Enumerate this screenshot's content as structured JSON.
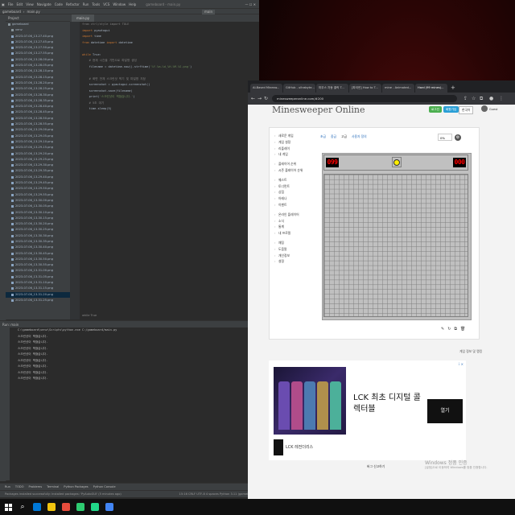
{
  "ide": {
    "menu": [
      "File",
      "Edit",
      "View",
      "Navigate",
      "Code",
      "Refactor",
      "Run",
      "Tools",
      "VCS",
      "Window",
      "Help"
    ],
    "window_title": "gameboard - main.py",
    "nav_project": "gameboard",
    "nav_file": "main.py",
    "run_config": "main",
    "project_header": "Project",
    "tab_label": "main.py",
    "tree": {
      "root": "gameboard",
      "venv": "venv",
      "files": [
        "2023-07-06_13-27-40.png",
        "2023-07-06_13-27-45.png",
        "2023-07-06_13-27-50.png",
        "2023-07-06_13-27-55.png",
        "2023-07-06_13-28-00.png",
        "2023-07-06_13-28-05.png",
        "2023-07-06_13-28-10.png",
        "2023-07-06_13-28-15.png",
        "2023-07-06_13-28-20.png",
        "2023-07-06_13-28-25.png",
        "2023-07-06_13-28-30.png",
        "2023-07-06_13-28-35.png",
        "2023-07-06_13-28-40.png",
        "2023-07-06_13-28-45.png",
        "2023-07-06_13-28-50.png",
        "2023-07-06_13-28-55.png",
        "2023-07-06_13-29-00.png",
        "2023-07-06_13-29-05.png",
        "2023-07-06_13-29-10.png",
        "2023-07-06_13-29-15.png",
        "2023-07-06_13-29-20.png",
        "2023-07-06_13-29-25.png",
        "2023-07-06_13-29-30.png",
        "2023-07-06_13-29-35.png",
        "2023-07-06_13-29-40.png",
        "2023-07-06_13-29-45.png",
        "2023-07-06_13-29-50.png",
        "2023-07-06_13-29-55.png",
        "2023-07-06_13-30-00.png",
        "2023-07-06_13-30-05.png",
        "2023-07-06_13-30-10.png",
        "2023-07-06_13-30-15.png",
        "2023-07-06_13-30-20.png",
        "2023-07-06_13-30-25.png",
        "2023-07-06_13-30-30.png",
        "2023-07-06_13-30-35.png",
        "2023-07-06_13-30-40.png",
        "2023-07-06_13-30-45.png",
        "2023-07-06_13-30-50.png",
        "2023-07-06_13-30-55.png",
        "2023-07-06_13-31-00.png",
        "2023-07-06_13-31-05.png",
        "2023-07-06_13-31-10.png",
        "2023-07-06_13-31-15.png",
        "2023-07-06_13-31-20.png",
        "2023-07-06_13-31-25.png"
      ],
      "selected_index": 44
    },
    "code": [
      {
        "parts": [
          [
            "cm",
            "from ctrl/style import TOLE"
          ]
        ]
      },
      {
        "parts": [
          [
            "kw",
            "import "
          ],
          [
            "",
            "pyautogui"
          ]
        ]
      },
      {
        "parts": [
          [
            "kw",
            "import "
          ],
          [
            "",
            "time"
          ]
        ]
      },
      {
        "parts": [
          [
            "kw",
            "from "
          ],
          [
            "",
            "datetime "
          ],
          [
            "kw",
            "import "
          ],
          [
            "",
            "datetime"
          ]
        ]
      },
      {
        "parts": [
          [
            "",
            ""
          ]
        ]
      },
      {
        "parts": [
          [
            "kw",
            "while "
          ],
          [
            "",
            "True:"
          ]
        ]
      },
      {
        "parts": [
          [
            "cm",
            "    # 현재 시간을 기반으로 파일명 생성"
          ]
        ]
      },
      {
        "parts": [
          [
            "",
            "    filename = datetime.now().strftime("
          ],
          [
            "st",
            "'%Y-%m-%d_%H-%M-%S.png'"
          ],
          [
            "",
            ")"
          ]
        ]
      },
      {
        "parts": [
          [
            "",
            ""
          ]
        ]
      },
      {
        "parts": [
          [
            "cm",
            "    # 화면 전체 스크린샷 찍기 및 파일명 지정"
          ]
        ]
      },
      {
        "parts": [
          [
            "",
            "    screenshot = pyautogui.screenshot()"
          ]
        ]
      },
      {
        "parts": [
          [
            "",
            "    screenshot.save(filename)"
          ]
        ]
      },
      {
        "parts": [
          [
            "",
            "    print("
          ],
          [
            "st",
            "'스크린샷이 찍혔습니다.'"
          ],
          [
            "",
            ")"
          ]
        ]
      },
      {
        "parts": [
          [
            "cm",
            "    # 5초 대기"
          ]
        ]
      },
      {
        "parts": [
          [
            "",
            "    time.sleep(5)"
          ]
        ]
      }
    ],
    "editor_footer": "while True",
    "run_header": "Run:   main",
    "run_command": "C:\\gameboard\\venv\\Scripts\\python.exe C:/gameboard/main.py",
    "run_output_line": "스크린샷이 찍혔습니다.",
    "run_output_count": 8,
    "bottom_tabs": [
      "Run",
      "TODO",
      "Problems",
      "Terminal",
      "Python Packages",
      "Python Console"
    ],
    "status_left": "Packages installed successfully: Installed packages: 'PyAutoGUI' (5 minutes ago)",
    "status_right": "15:16  CRLF  UTF-8  4 spaces  Python 3.11 (gameboard)"
  },
  "browser": {
    "tabs": [
      "AI-Based Minesw...",
      "GitHub - ultrabyte...",
      "마우스 자동 클릭 T...",
      "[파이썬] How to T...",
      "mine - Animated...",
      "Hard (99 mines)..."
    ],
    "url": "minesweeperonline.com/#200",
    "site": {
      "logo": "Minesweeper Online",
      "btn_login": "로그인",
      "btn_signup": "회원가입",
      "lang": "한국어",
      "user": "Guest",
      "menu_groups": [
        [
          "새로운 게임",
          "게임 설정",
          "리플레이",
          "내 게임"
        ],
        [
          "플레이어 순위",
          "시즌 플레이어 순위"
        ],
        [
          "퀘스트",
          "토너먼트",
          "상점",
          "아레나",
          "이벤트"
        ],
        [
          "온라인 플레이어",
          "소식",
          "통계",
          "내 프로필"
        ],
        [
          "채팅",
          "도움말",
          "개인정보",
          "설정"
        ]
      ],
      "level_tabs": [
        "초급",
        "중급",
        "고급",
        "사용자 정의"
      ],
      "active_level_index": 2,
      "zoom": "0%",
      "mines_counter": "099",
      "timer": "000",
      "grid_cols": 30,
      "grid_rows": 30,
      "game_info": "게임 정보 및 랭킹",
      "report": "버그 신고하기"
    },
    "ad": {
      "title": "LCK 최초 디지털 콜렉터블",
      "cta": "열기",
      "brand": "LCK 레전더리스",
      "info": "i ×"
    }
  },
  "windows_watermark": {
    "line1": "Windows 정품 인증",
    "line2": "[설정]으로 이동하여 Windows를 정품 인증합니다."
  },
  "taskbar_colors": [
    "#0078d7",
    "#f1c40f",
    "#e74c3c",
    "#2ecc71",
    "#21d789",
    "#4285f4"
  ]
}
